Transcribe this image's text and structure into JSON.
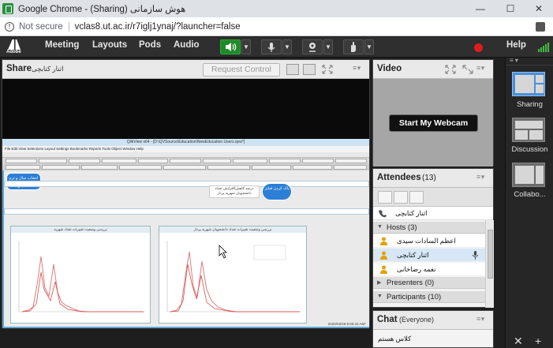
{
  "window": {
    "title": "Google Chrome - (Sharing) هوش سازمانی",
    "minimize": "—",
    "maximize": "☐",
    "close": "✕"
  },
  "address": {
    "security": "Not secure",
    "url": "vclas8.ut.ac.ir/r7iglj1ynaj/?launcher=false"
  },
  "toolbar": {
    "logo_text": "Adobe",
    "menus": [
      "Meeting",
      "Layouts",
      "Pods",
      "Audio"
    ],
    "help": "Help",
    "colors": {
      "speaker_active": "#1f8a2a",
      "record": "#e01c1c",
      "signal": "#3fbf3f"
    }
  },
  "share_pod": {
    "title": "Share",
    "presenter": "اثنار کتابچی",
    "request_control": "Request Control",
    "screen": {
      "app_title": "QlikView x64 - [D:\\QVSource\\Education\\NewEducation Users.qvw*]",
      "menu": "File  Edit  View  Selections  Layout  Settings  Bookmarks  Reports  Tools  Object  Window  Help",
      "button_left": "انتخاب سال و ترم تحصیلی",
      "button_right": "پاک کردن فیلتر",
      "label_center": "درصد کاهش/افزایش تعداد دانشجویان شهریه پرداز",
      "chart_left_title": "بررسی وضعیت تغییرات تعداد شهریه",
      "chart_right_title": "بررسی وضعیت تغییرات تعداد دانشجویان شهریه پرداز",
      "status": "2020/03/28   8:05:43 AM*"
    }
  },
  "video_pod": {
    "title": "Video",
    "start_webcam": "Start My Webcam"
  },
  "attendees_pod": {
    "title": "Attendees",
    "count": "(13)",
    "me": "اثنار کتابچی",
    "groups": [
      {
        "label": "Hosts (3)",
        "expanded": true
      },
      {
        "label": "Presenters (0)",
        "expanded": false
      },
      {
        "label": "Participants (10)",
        "expanded": true
      }
    ],
    "hosts": [
      {
        "name": "اعظم السادات سیدی",
        "selected": false,
        "mic": false
      },
      {
        "name": "اثنار کتابچی",
        "selected": true,
        "mic": true
      },
      {
        "name": "نغمه رضاخانی",
        "selected": false,
        "mic": false
      }
    ]
  },
  "chat_pod": {
    "title": "Chat",
    "scope": "(Everyone)",
    "message": "کلاس هستم"
  },
  "layouts_bar": {
    "items": [
      {
        "label": "Sharing",
        "active": true
      },
      {
        "label": "Discussion",
        "active": false
      },
      {
        "label": "Collabo...",
        "active": false
      }
    ]
  }
}
